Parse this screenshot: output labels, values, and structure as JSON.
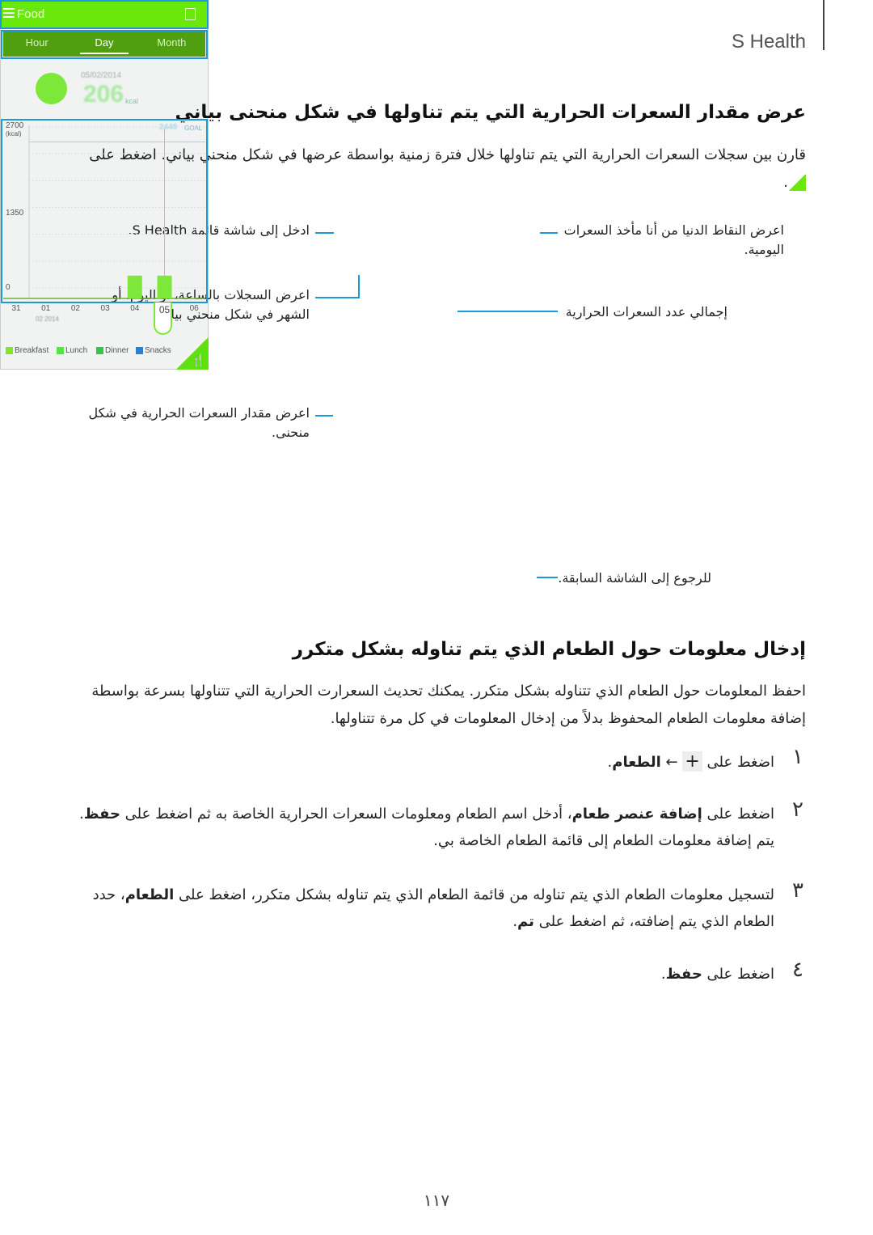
{
  "header": {
    "app_name": "S Health"
  },
  "section1": {
    "title": "عرض مقدار السعرات الحرارية التي يتم تناولها في شكل منحنى بياني",
    "body": "قارن بين سجلات السعرات الحرارية التي يتم تناولها خلال فترة زمنية بواسطة عرضها في شكل منحني بياني. اضغط على",
    "body_end": ".",
    "icon": "chart-icon"
  },
  "callouts": {
    "menu": "ادخل إلى شاشة قائمة S Health.",
    "tabs": "اعرض السجلات بالساعة، أو اليوم، أو الشهر في شكل منحني بياني.",
    "graph": "اعرض مقدار السعرات الحرارية في شكل منحنى.",
    "min": "اعرض النقاط الدنيا من أنا مأخذ السعرات اليومية.",
    "total": "إجمالي عدد السعرات الحرارية",
    "back": "للرجوع إلى الشاشة السابقة."
  },
  "phone": {
    "title": "Food",
    "tabs": [
      "Hour",
      "Day",
      "Month"
    ],
    "selected_tab": "Day",
    "date": "05/02/2014",
    "total": "206",
    "unit": "kcal",
    "chart": {
      "y_ticks": [
        "2700",
        "1350",
        "0"
      ],
      "y_unit": "(kcal)",
      "ylim": [
        0,
        2700
      ],
      "goal_value": "2449",
      "goal_label": "GOAL",
      "x_labels": [
        "31",
        "01",
        "02",
        "03",
        "04",
        "05",
        "06"
      ],
      "month_label": "02 2014",
      "selected_x": "05",
      "bars": [
        {
          "x": "04",
          "value": 206
        },
        {
          "x": "05",
          "value": 206
        }
      ],
      "legend": [
        {
          "name": "Breakfast",
          "color": "#7fe62a"
        },
        {
          "name": "Lunch",
          "color": "#4fe83c"
        },
        {
          "name": "Dinner",
          "color": "#36c444"
        },
        {
          "name": "Snacks",
          "color": "#2a7fd0"
        }
      ]
    },
    "colors": {
      "header": "#6ae80c",
      "tabbar": "#4f9f0e",
      "callout": "#1a9ad6"
    }
  },
  "section2": {
    "title": "إدخال معلومات حول الطعام الذي يتم تناوله بشكل متكرر",
    "body": "احفظ المعلومات حول الطعام الذي تتناوله بشكل متكرر. يمكنك تحديث السعرارت الحرارية التي تتناولها بسرعة بواسطة إضافة معلومات الطعام المحفوظ بدلاً من إدخال المعلومات في كل مرة تتناولها."
  },
  "steps": [
    {
      "num": "١",
      "segs": [
        "اضغط على ",
        "+",
        " ← ",
        "الطعام",
        "."
      ]
    },
    {
      "num": "٢",
      "segs": [
        "اضغط على ",
        "إضافة عنصر طعام",
        "، أدخل اسم الطعام ومعلومات السعرات الحرارية الخاصة به ثم اضغط على ",
        "حفظ",
        ". يتم إضافة معلومات الطعام إلى قائمة الطعام الخاصة بي."
      ]
    },
    {
      "num": "٣",
      "segs": [
        "لتسجيل معلومات الطعام الذي يتم تناوله من قائمة الطعام الذي يتم تناوله بشكل متكرر، اضغط على ",
        "الطعام",
        "، حدد الطعام الذي يتم إضافته، ثم اضغط على ",
        "تم",
        "."
      ]
    },
    {
      "num": "٤",
      "segs": [
        "اضغط على ",
        "حفظ",
        "."
      ]
    }
  ],
  "page_number": "١١٧"
}
